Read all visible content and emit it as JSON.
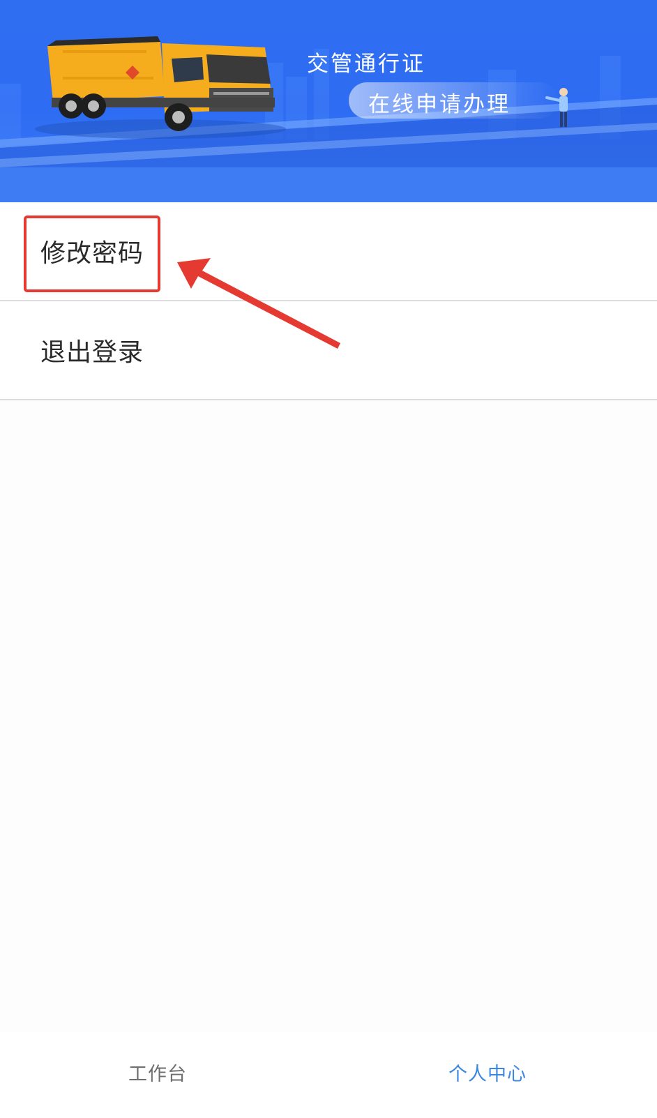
{
  "banner": {
    "title": "交管通行证",
    "subtitle": "在线申请办理",
    "truck_color": "#f6ad1d",
    "background_color": "#2e6cf3"
  },
  "menu": {
    "items": [
      {
        "label": "修改密码"
      },
      {
        "label": "退出登录"
      }
    ]
  },
  "annotation": {
    "color": "#e53a31"
  },
  "tabbar": {
    "tabs": [
      {
        "label": "工作台",
        "active": false
      },
      {
        "label": "个人中心",
        "active": true
      }
    ],
    "active_color": "#3b86e0"
  }
}
